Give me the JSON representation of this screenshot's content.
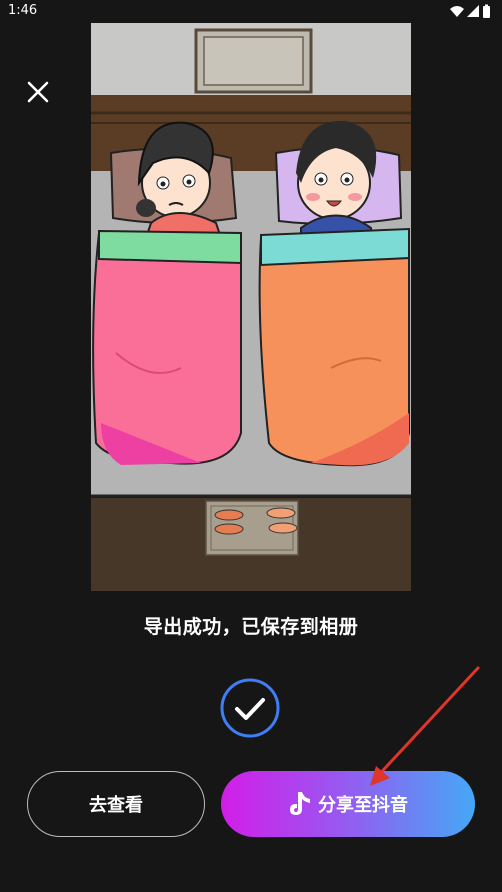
{
  "status_bar": {
    "time": "1:46"
  },
  "icons": {
    "close": "close-icon",
    "wifi": "wifi-icon",
    "signal": "signal-icon",
    "battery": "battery-icon",
    "check": "check-icon",
    "tiktok": "tiktok-logo-icon"
  },
  "preview": {
    "description_hidden": ""
  },
  "message": "导出成功，已保存到相册",
  "buttons": {
    "view_label": "去查看",
    "share_label": "分享至抖音"
  },
  "colors": {
    "background": "#161616",
    "check_ring": "#3f7ef5",
    "annotation_arrow": "#e0352b"
  }
}
